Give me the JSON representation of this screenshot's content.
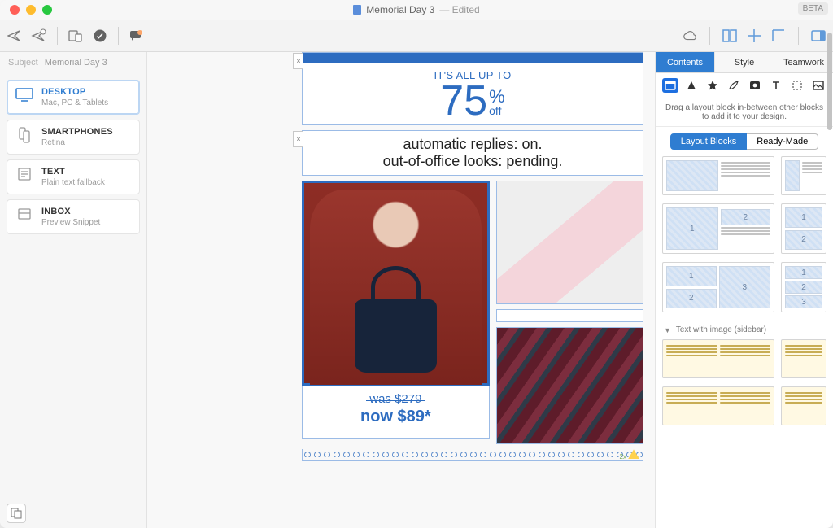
{
  "title": {
    "doc": "Memorial Day 3",
    "edited": "— Edited",
    "beta": "BETA"
  },
  "subject": {
    "label": "Subject",
    "value": "Memorial Day 3"
  },
  "viewports": [
    {
      "title": "DESKTOP",
      "sub": "Mac, PC & Tablets",
      "active": true
    },
    {
      "title": "SMARTPHONES",
      "sub": "Retina",
      "active": false
    },
    {
      "title": "TEXT",
      "sub": "Plain text fallback",
      "active": false
    },
    {
      "title": "INBOX",
      "sub": "Preview Snippet",
      "active": false
    }
  ],
  "email": {
    "hero_sup": "IT'S ALL UP TO",
    "hero_num": "75",
    "hero_pct": "%",
    "hero_off": "off",
    "line1": "automatic replies: on.",
    "line2": "out-of-office looks: pending.",
    "was": "was $279",
    "now": "now $89*",
    "zoom_badge": "2x"
  },
  "panel": {
    "tabs": [
      "Contents",
      "Style",
      "Teamwork"
    ],
    "active_tab": 0,
    "hint": "Drag a layout block in-between other blocks to add it to your design.",
    "seg": [
      "Layout Blocks",
      "Ready-Made"
    ],
    "seg_active": 0,
    "section2_title": "Text with image (sidebar)",
    "thumb_nums": {
      "one": "1",
      "two": "2",
      "three": "3"
    }
  }
}
